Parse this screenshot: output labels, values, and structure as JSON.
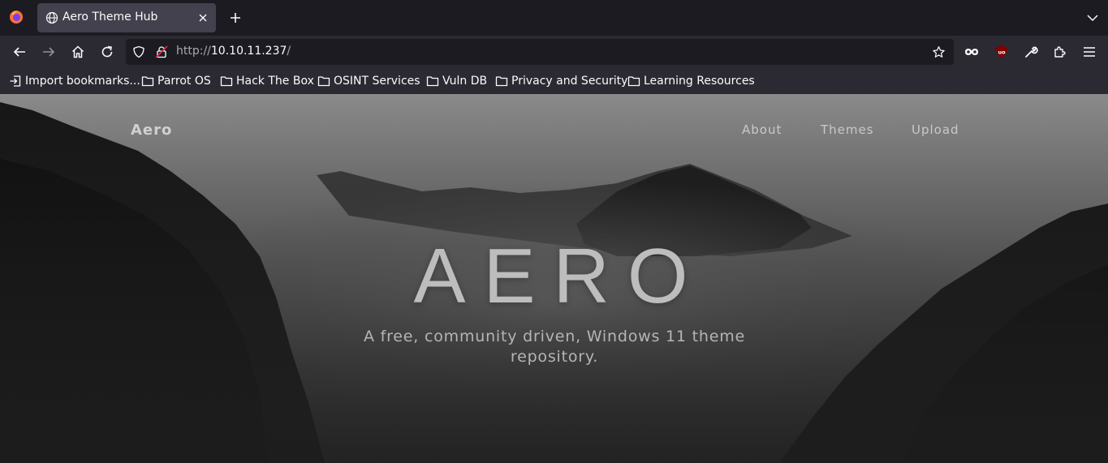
{
  "browser": {
    "tab": {
      "title": "Aero Theme Hub"
    },
    "url": {
      "prefix": "http://",
      "host": "10.10.11.237",
      "path": "/"
    },
    "bookmarks": [
      {
        "label": "Import bookmarks...",
        "icon": "import-icon"
      },
      {
        "label": "Parrot OS",
        "icon": "folder-icon"
      },
      {
        "label": "Hack The Box",
        "icon": "folder-icon"
      },
      {
        "label": "OSINT Services",
        "icon": "folder-icon"
      },
      {
        "label": "Vuln DB",
        "icon": "folder-icon"
      },
      {
        "label": "Privacy and Security",
        "icon": "folder-icon"
      },
      {
        "label": "Learning Resources",
        "icon": "folder-icon"
      }
    ],
    "colors": {
      "tabbar": "#1c1b22",
      "toolbar": "#2b2a33",
      "active_tab": "#42414d",
      "text": "#fbfbfe"
    }
  },
  "site": {
    "brand": "Aero",
    "nav": [
      "About",
      "Themes",
      "Upload"
    ],
    "hero": {
      "title": "AERO",
      "subtitle": "A free, community driven, Windows 11 theme repository."
    }
  }
}
